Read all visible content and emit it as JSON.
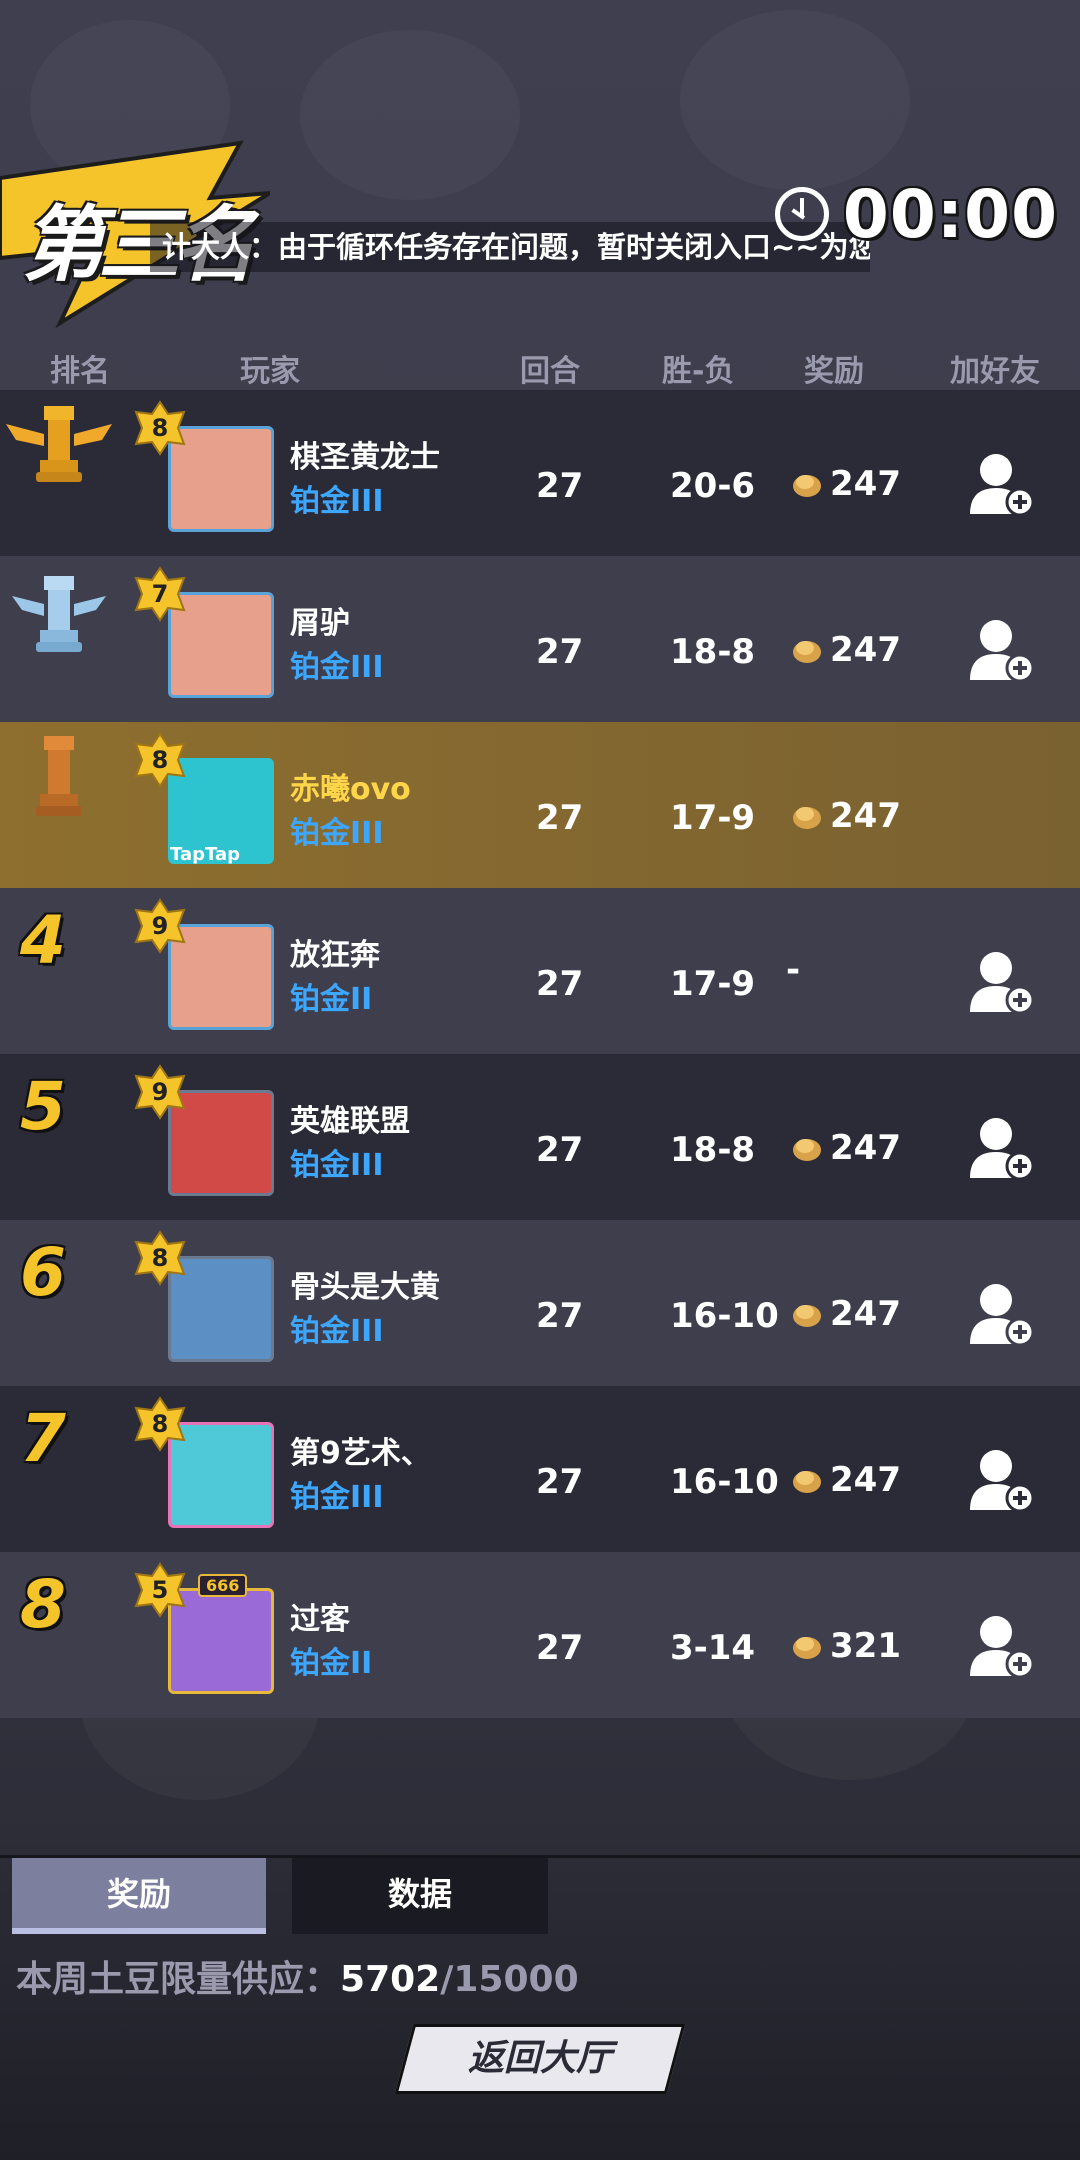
{
  "header": {
    "rank_title": "第三名",
    "marquee_text": "计大人：由于循环任务存在问题，暂时关闭入口~~为您带",
    "timer": "00:00"
  },
  "columns": {
    "rank": "排名",
    "player": "玩家",
    "rounds": "回合",
    "win_loss": "胜-负",
    "reward": "奖励",
    "add_friend": "加好友"
  },
  "rows": [
    {
      "rank_icon": "gold-rook-icon",
      "level": "8",
      "name": "棋圣黄龙士",
      "tier": "铂金III",
      "rounds": "27",
      "win_loss": "20-6",
      "reward": "247",
      "avatar_color": "#e7a08c"
    },
    {
      "rank_icon": "silver-rook-icon",
      "level": "7",
      "name": "屑驴",
      "tier": "铂金III",
      "rounds": "27",
      "win_loss": "18-8",
      "reward": "247",
      "avatar_color": "#e7a08c"
    },
    {
      "rank_icon": "bronze-rook-icon",
      "level": "8",
      "name": "赤曦ovo",
      "tier": "铂金III",
      "rounds": "27",
      "win_loss": "17-9",
      "reward": "247",
      "avatar_color": "#2ec4cf",
      "avatar_tag": "TapTap"
    },
    {
      "rank": "4",
      "level": "9",
      "name": "放狂奔",
      "tier": "铂金II",
      "rounds": "27",
      "win_loss": "17-9",
      "reward": "-",
      "avatar_color": "#e7a08c"
    },
    {
      "rank": "5",
      "level": "9",
      "name": "英雄联盟",
      "tier": "铂金III",
      "rounds": "27",
      "win_loss": "18-8",
      "reward": "247",
      "avatar_color": "#d24a48"
    },
    {
      "rank": "6",
      "level": "8",
      "name": "骨头是大黄",
      "tier": "铂金III",
      "rounds": "27",
      "win_loss": "16-10",
      "reward": "247",
      "avatar_color": "#5c8fc4"
    },
    {
      "rank": "7",
      "level": "8",
      "name": "第9艺术、",
      "tier": "铂金III",
      "rounds": "27",
      "win_loss": "16-10",
      "reward": "247",
      "avatar_color": "#4fc9d8"
    },
    {
      "rank": "8",
      "level": "5",
      "name": "过客",
      "tier": "铂金II",
      "rounds": "27",
      "win_loss": "3-14",
      "reward": "321",
      "avatar_color": "#9a6ad6",
      "badge_extra": "666"
    }
  ],
  "tabs": {
    "reward": "奖励",
    "data": "数据"
  },
  "supply": {
    "label": "本周土豆限量供应：",
    "current": "5702",
    "total": "/15000"
  },
  "back_button": "返回大厅",
  "colors": {
    "gold": "#f5c42b",
    "tier_blue": "#3da7ff",
    "self_row": "#8e6f2f"
  }
}
